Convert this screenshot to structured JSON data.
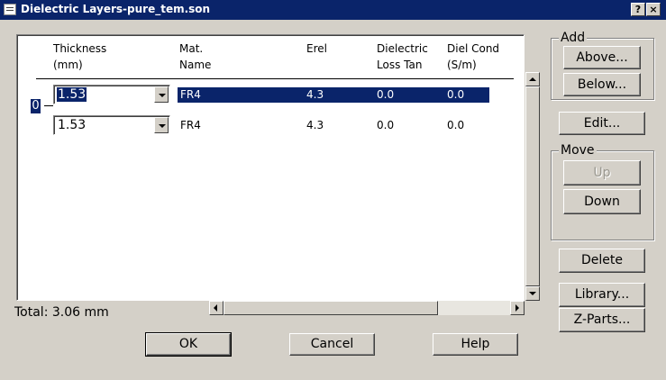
{
  "window": {
    "title": "Dielectric Layers-pure_tem.son",
    "help_label": "?",
    "close_label": "×"
  },
  "table": {
    "headers": [
      {
        "line1": "Thickness",
        "line2": "(mm)"
      },
      {
        "line1": "Mat.",
        "line2": "Name"
      },
      {
        "line1": "Erel",
        "line2": ""
      },
      {
        "line1": "Dielectric",
        "line2": "Loss Tan"
      },
      {
        "line1": "Diel Cond",
        "line2": "(S/m)"
      }
    ],
    "rows": [
      {
        "thickness": "1.53",
        "material": "FR4",
        "erel": "4.3",
        "loss_tan": "0.0",
        "diel_cond": "0.0"
      },
      {
        "thickness": "1.53",
        "material": "FR4",
        "erel": "4.3",
        "loss_tan": "0.0",
        "diel_cond": "0.0"
      }
    ],
    "metal_level_label": "0",
    "selected_row": 0
  },
  "total_label": "Total: 3.06 mm",
  "add_group": {
    "label": "Add",
    "above": "Above...",
    "below": "Below..."
  },
  "edit_button": "Edit...",
  "move_group": {
    "label": "Move",
    "up": "Up",
    "down": "Down"
  },
  "delete_button": "Delete",
  "library_button": "Library...",
  "zparts_button": "Z-Parts...",
  "footer": {
    "ok": "OK",
    "cancel": "Cancel",
    "help": "Help"
  },
  "colors": {
    "titlebar": "#0a246a",
    "selection": "#0a246a",
    "face": "#d4d0c8"
  }
}
